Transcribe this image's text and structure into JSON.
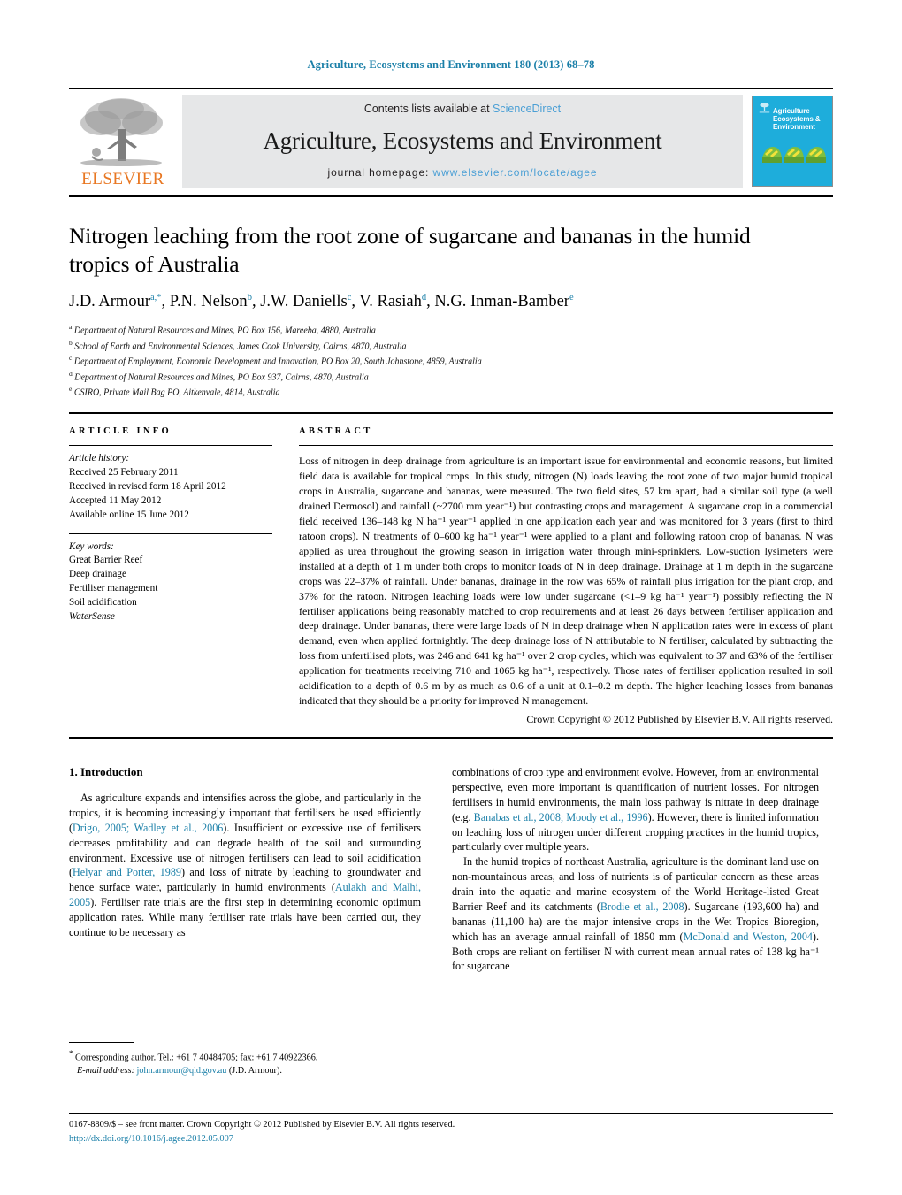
{
  "running_head": "Agriculture, Ecosystems and Environment 180 (2013) 68–78",
  "masthead": {
    "contents_prefix": "Contents lists available at ",
    "sciencedirect": "ScienceDirect",
    "journal_title": "Agriculture, Ecosystems and Environment",
    "homepage_prefix": "journal homepage: ",
    "homepage_url": "www.elsevier.com/locate/agee",
    "elsevier_word": "ELSEVIER",
    "cover_title": "Agriculture\nEcosystems &\nEnvironment",
    "cover_color": "#1eaddb",
    "link_color": "#4a9fd5"
  },
  "article": {
    "title": "Nitrogen leaching from the root zone of sugarcane and bananas in the humid tropics of Australia",
    "authors": [
      {
        "name": "J.D. Armour",
        "sup": "a,",
        "star": true
      },
      {
        "name": "P.N. Nelson",
        "sup": "b",
        "star": false
      },
      {
        "name": "J.W. Daniells",
        "sup": "c",
        "star": false
      },
      {
        "name": "V. Rasiah",
        "sup": "d",
        "star": false
      },
      {
        "name": "N.G. Inman-Bamber",
        "sup": "e",
        "star": false
      }
    ],
    "affiliations": [
      {
        "label": "a",
        "text": "Department of Natural Resources and Mines, PO Box 156, Mareeba, 4880, Australia"
      },
      {
        "label": "b",
        "text": "School of Earth and Environmental Sciences, James Cook University, Cairns, 4870, Australia"
      },
      {
        "label": "c",
        "text": "Department of Employment, Economic Development and Innovation, PO Box 20, South Johnstone, 4859, Australia"
      },
      {
        "label": "d",
        "text": "Department of Natural Resources and Mines, PO Box 937, Cairns, 4870, Australia"
      },
      {
        "label": "e",
        "text": "CSIRO, Private Mail Bag PO, Aitkenvale, 4814, Australia"
      }
    ]
  },
  "article_info": {
    "heading": "ARTICLE INFO",
    "history_label": "Article history:",
    "history": [
      "Received 25 February 2011",
      "Received in revised form 18 April 2012",
      "Accepted 11 May 2012",
      "Available online 15 June 2012"
    ],
    "keywords_label": "Key words:",
    "keywords": [
      "Great Barrier Reef",
      "Deep drainage",
      "Fertiliser management",
      "Soil acidification",
      "WaterSense"
    ]
  },
  "abstract": {
    "heading": "ABSTRACT",
    "text": "Loss of nitrogen in deep drainage from agriculture is an important issue for environmental and economic reasons, but limited field data is available for tropical crops. In this study, nitrogen (N) loads leaving the root zone of two major humid tropical crops in Australia, sugarcane and bananas, were measured. The two field sites, 57 km apart, had a similar soil type (a well drained Dermosol) and rainfall (~2700 mm year⁻¹) but contrasting crops and management. A sugarcane crop in a commercial field received 136–148 kg N ha⁻¹ year⁻¹ applied in one application each year and was monitored for 3 years (first to third ratoon crops). N treatments of 0–600 kg ha⁻¹ year⁻¹ were applied to a plant and following ratoon crop of bananas. N was applied as urea throughout the growing season in irrigation water through mini-sprinklers. Low-suction lysimeters were installed at a depth of 1 m under both crops to monitor loads of N in deep drainage. Drainage at 1 m depth in the sugarcane crops was 22–37% of rainfall. Under bananas, drainage in the row was 65% of rainfall plus irrigation for the plant crop, and 37% for the ratoon. Nitrogen leaching loads were low under sugarcane (<1–9 kg ha⁻¹ year⁻¹) possibly reflecting the N fertiliser applications being reasonably matched to crop requirements and at least 26 days between fertiliser application and deep drainage. Under bananas, there were large loads of N in deep drainage when N application rates were in excess of plant demand, even when applied fortnightly. The deep drainage loss of N attributable to N fertiliser, calculated by subtracting the loss from unfertilised plots, was 246 and 641 kg ha⁻¹ over 2 crop cycles, which was equivalent to 37 and 63% of the fertiliser application for treatments receiving 710 and 1065 kg ha⁻¹, respectively. Those rates of fertiliser application resulted in soil acidification to a depth of 0.6 m by as much as 0.6 of a unit at 0.1–0.2 m depth. The higher leaching losses from bananas indicated that they should be a priority for improved N management.",
    "copyright": "Crown Copyright © 2012 Published by Elsevier B.V. All rights reserved."
  },
  "introduction": {
    "heading": "1.  Introduction",
    "left_paragraph_1_a": "As agriculture expands and intensifies across the globe, and particularly in the tropics, it is becoming increasingly important that fertilisers be used efficiently (",
    "left_ref_1": "Drigo, 2005; Wadley et al., 2006",
    "left_paragraph_1_b": "). Insufficient or excessive use of fertilisers decreases profitability and can degrade health of the soil and surrounding environment. Excessive use of nitrogen fertilisers can lead to soil acidification (",
    "left_ref_2": "Helyar and Porter, 1989",
    "left_paragraph_1_c": ") and loss of nitrate by leaching to groundwater and hence surface water, particularly in humid environments (",
    "left_ref_3": "Aulakh and Malhi, 2005",
    "left_paragraph_1_d": "). Fertiliser rate trials are the first step in determining economic optimum application rates. While many fertiliser rate trials have been carried out, they continue to be necessary as",
    "right_paragraph_1_a": "combinations of crop type and environment evolve. However, from an environmental perspective, even more important is quantification of nutrient losses. For nitrogen fertilisers in humid environments, the main loss pathway is nitrate in deep drainage (e.g. ",
    "right_ref_1": "Banabas et al., 2008; Moody et al., 1996",
    "right_paragraph_1_b": "). However, there is limited information on leaching loss of nitrogen under different cropping practices in the humid tropics, particularly over multiple years.",
    "right_paragraph_2_a": "In the humid tropics of northeast Australia, agriculture is the dominant land use on non-mountainous areas, and loss of nutrients is of particular concern as these areas drain into the aquatic and marine ecosystem of the World Heritage-listed Great Barrier Reef and its catchments (",
    "right_ref_2": "Brodie et al., 2008",
    "right_paragraph_2_b": "). Sugarcane (193,600 ha) and bananas (11,100 ha) are the major intensive crops in the Wet Tropics Bioregion, which has an average annual rainfall of 1850 mm (",
    "right_ref_3": "McDonald and Weston, 2004",
    "right_paragraph_2_c": "). Both crops are reliant on fertiliser N with current mean annual rates of 138 kg ha⁻¹ for sugarcane"
  },
  "footnote": {
    "star": "*",
    "corresponding": "Corresponding author. Tel.: +61 7 40484705; fax: +61 7 40922366.",
    "email_label": "E-mail address:",
    "email": "john.armour@qld.gov.au",
    "email_suffix": "(J.D. Armour)."
  },
  "footer": {
    "issn_line": "0167-8809/$ – see front matter. Crown Copyright © 2012 Published by Elsevier B.V. All rights reserved.",
    "doi": "http://dx.doi.org/10.1016/j.agee.2012.05.007"
  }
}
